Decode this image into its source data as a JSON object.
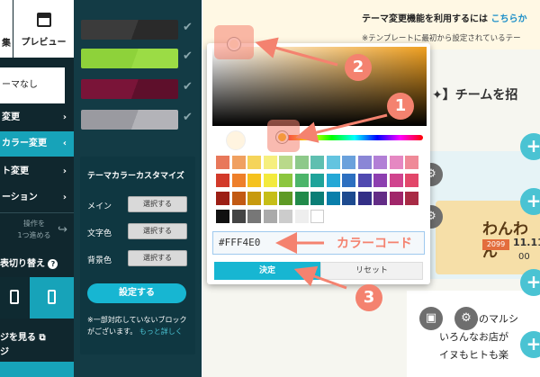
{
  "sidebar": {
    "top_left_label": "集",
    "preview_label": "プレビュー",
    "theme_value": "ーマなし",
    "rows": [
      {
        "label": "変更",
        "chev": "›",
        "active": false
      },
      {
        "label": "カラー変更",
        "chev": "‹",
        "active": true
      },
      {
        "label": "ト変更",
        "chev": "›",
        "active": false
      },
      {
        "label": "ーション",
        "chev": "›",
        "active": false
      }
    ],
    "redo_label_1": "操作を",
    "redo_label_2": "1つ進める",
    "switch_label": "表切り替え",
    "view_page_label": "ジを見る",
    "view_page_label2": "ジ"
  },
  "panel": {
    "swatches": [
      {
        "c1": "#3b3b3b",
        "c2": "#2a2a2a"
      },
      {
        "c1": "#8ed23a",
        "c2": "#9bdc45"
      },
      {
        "c1": "#7a1438",
        "c2": "#5e0f2b"
      },
      {
        "c1": "#9a9aa0",
        "c2": "#b3b3b8"
      }
    ],
    "custom_title": "テーマカラーカスタマイズ",
    "fields": [
      {
        "label": "メイン",
        "button": "選択する"
      },
      {
        "label": "文字色",
        "button": "選択する"
      },
      {
        "label": "背景色",
        "button": "選択する"
      }
    ],
    "apply_label": "設定する",
    "note_text": "※一部対応していないブロックがございます。",
    "note_link": "もっと詳しく"
  },
  "page": {
    "banner_text": "テーマ変更機能を利用するには",
    "banner_link": "こちらか",
    "banner_sub": "※テンプレートに最初から設定されているテー",
    "invite_heading": "】チームを招",
    "flyer_title": "わんわん",
    "flyer_date": "2099",
    "flyer_date2": "11.11",
    "flyer_sub": "00",
    "body_line1": "ためのマルシ",
    "body_line2": "いろんなお店が",
    "body_line3": "イヌもヒトも楽"
  },
  "picker": {
    "palette": [
      [
        "#e8785a",
        "#f0a060",
        "#f5d45a",
        "#f6ef7e",
        "#b9d98a",
        "#8dc98a",
        "#5fbfb0",
        "#63c4e0",
        "#6aa1dc",
        "#8a86d6",
        "#b27fd6",
        "#e588c2",
        "#ef8a98"
      ],
      [
        "#d23a2a",
        "#ee7f2a",
        "#f5c21e",
        "#f3ea3d",
        "#8cc63e",
        "#4cb56a",
        "#1fa39a",
        "#25a8d6",
        "#2c6fc0",
        "#5049b0",
        "#8d3fb0",
        "#d0448e",
        "#e2476a"
      ],
      [
        "#9c1f15",
        "#c25a14",
        "#c79a0f",
        "#c6be17",
        "#5e9a25",
        "#218a4a",
        "#0b7e76",
        "#0a7fab",
        "#1d4a8f",
        "#332f86",
        "#632c86",
        "#a0266a",
        "#a82b45"
      ],
      [
        "#111111",
        "#444444",
        "#777777",
        "#aaaaaa",
        "#cccccc",
        "#eeeeee",
        "#ffffff"
      ]
    ],
    "hex_value": "#FFF4E0",
    "ok_label": "決定",
    "reset_label": "リセット",
    "selected_preview": "#FFF4E0"
  },
  "annotations": {
    "num1": "1",
    "num2": "2",
    "num3": "3",
    "color_code_label": "カラーコード"
  }
}
